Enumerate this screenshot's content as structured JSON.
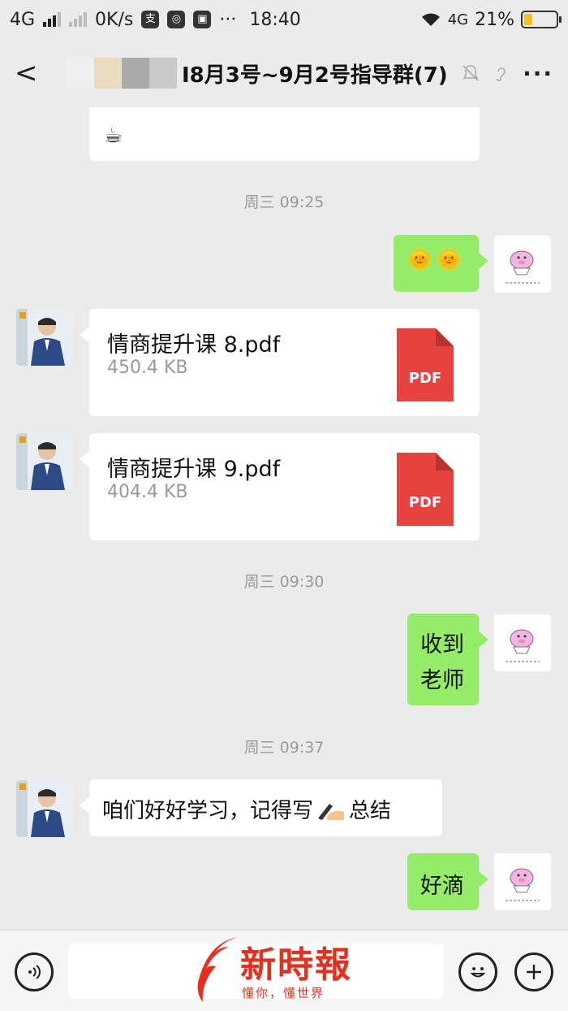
{
  "status_bar": {
    "network_left": "4G",
    "speed": "0K/s",
    "time": "18:40",
    "network_right": "4G",
    "battery": "21%"
  },
  "header": {
    "title": "I8月3号~9月2号指导群(7)"
  },
  "messages": {
    "ts1": "周三 09:25",
    "m1_emoji": "🌞🌞",
    "file1_name": "情商提升课 8.pdf",
    "file1_size": "450.4 KB",
    "file2_name": "情商提升课 9.pdf",
    "file2_size": "404.4 KB",
    "pdf_label": "PDF",
    "ts2": "周三 09:30",
    "m2_line1": "收到",
    "m2_line2": "老师",
    "ts3": "周三 09:37",
    "m3_before": "咱们好好学习，记得写",
    "m3_after": " 总结",
    "m4": "好滴",
    "top_emoji": "☕"
  },
  "watermark": {
    "title": "新時報",
    "subtitle": "懂你，懂世界"
  },
  "colors": {
    "self_bubble": "#95ec69",
    "other_bubble": "#ffffff",
    "background": "#ebebeb",
    "pdf_red": "#e64340"
  }
}
